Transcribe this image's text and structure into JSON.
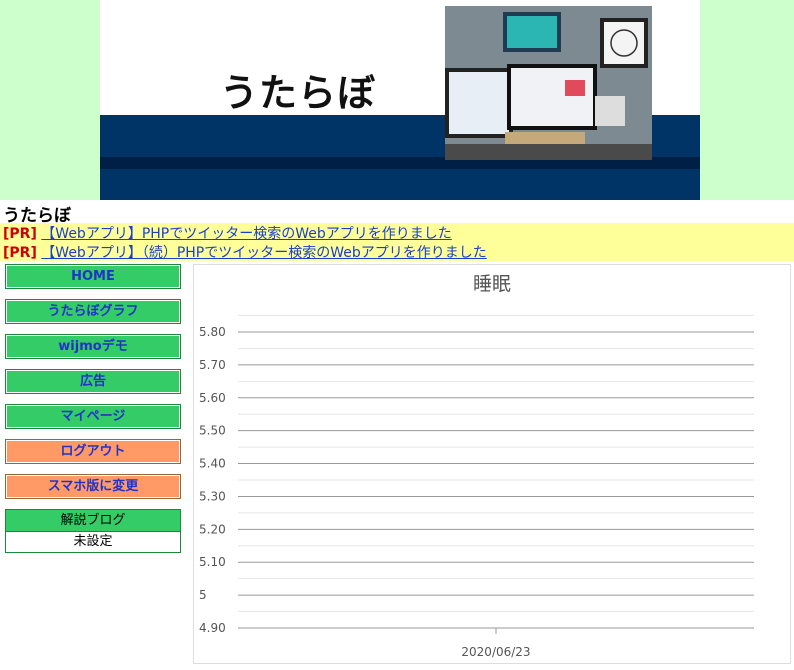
{
  "header": {
    "logo_text": "うたらぼ"
  },
  "site_title": "うたらぼ",
  "pr": [
    {
      "tag": "[PR]",
      "text": "【Webアプリ】PHPでツイッター検索のWebアプリを作りました"
    },
    {
      "tag": "[PR]",
      "text": "【Webアプリ】（続）PHPでツイッター検索のWebアプリを作りました"
    }
  ],
  "sidebar": {
    "items": [
      {
        "label": "HOME"
      },
      {
        "label": "うたらぼグラフ"
      },
      {
        "label": "wijmoデモ"
      },
      {
        "label": "広告"
      },
      {
        "label": "マイページ"
      },
      {
        "label": "ログアウト"
      },
      {
        "label": "スマホ版に変更"
      }
    ],
    "blog": {
      "heading": "解説ブログ",
      "value": "未設定"
    }
  },
  "colors": {
    "banner_bg": "#ccffcc",
    "pr_bg": "#ffff99",
    "nav_green": "#33cc66",
    "nav_orange": "#ff9966",
    "link": "#1a3ecc"
  },
  "chart_data": {
    "type": "line",
    "title": "睡眠",
    "x": [
      "2020/06/23"
    ],
    "series": [
      {
        "values": []
      }
    ],
    "ylim": [
      4.9,
      5.8
    ],
    "yticks": [
      "4.90",
      "5",
      "5.10",
      "5.20",
      "5.30",
      "5.40",
      "5.50",
      "5.60",
      "5.70",
      "5.80"
    ],
    "grid": true
  }
}
